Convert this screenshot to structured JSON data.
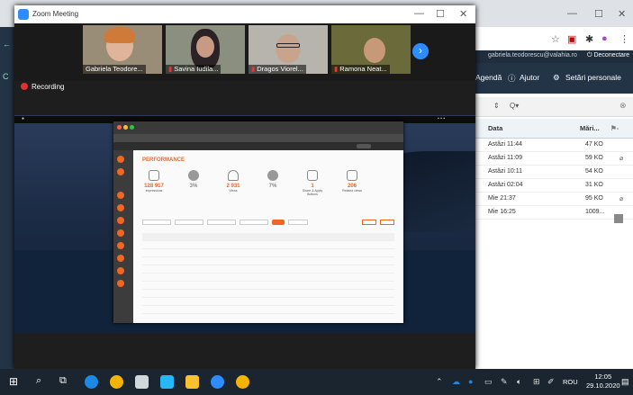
{
  "zoom": {
    "window_title": "Zoom Meeting",
    "recording_label": "Recording",
    "participants": [
      {
        "name": "Gabriela Teodore..."
      },
      {
        "name": "Savina Iudila..."
      },
      {
        "name": "Dragos Viorel..."
      },
      {
        "name": "Ramona Neat..."
      }
    ],
    "next_arrow": "›"
  },
  "shared_app": {
    "page_title": "PERFORMANCE",
    "kpis": [
      {
        "value": "128 917",
        "label": "Impressions"
      },
      {
        "value": "3%",
        "label": ""
      },
      {
        "value": "2 931",
        "label": "Views"
      },
      {
        "value": "7%",
        "label": ""
      },
      {
        "value": "1",
        "label": "Share & Apply Buttons"
      },
      {
        "value": "206",
        "label": "Related views"
      }
    ]
  },
  "browser": {
    "user_email": "gabriela.teodorescu@valahia.ro",
    "logout_label": "Deconectare",
    "menu": {
      "agenda": "Agendă",
      "help": "Ajutor",
      "settings": "Setări personale"
    },
    "mail_columns": {
      "date": "Data",
      "size": "Mări..."
    },
    "mail_rows": [
      {
        "date": "Astăzi 11:44",
        "size": "47 KO"
      },
      {
        "date": "Astăzi 11:09",
        "size": "59 KO"
      },
      {
        "date": "Astăzi 10:11",
        "size": "54 KO"
      },
      {
        "date": "Astăzi 02:04",
        "size": "31 KO"
      },
      {
        "date": "Mie 21:37",
        "size": "95 KO"
      },
      {
        "date": "Mie 16:25",
        "size": "1009..."
      }
    ]
  },
  "taskbar": {
    "language": "ROU",
    "time": "12:05",
    "date": "29.10.2020"
  }
}
